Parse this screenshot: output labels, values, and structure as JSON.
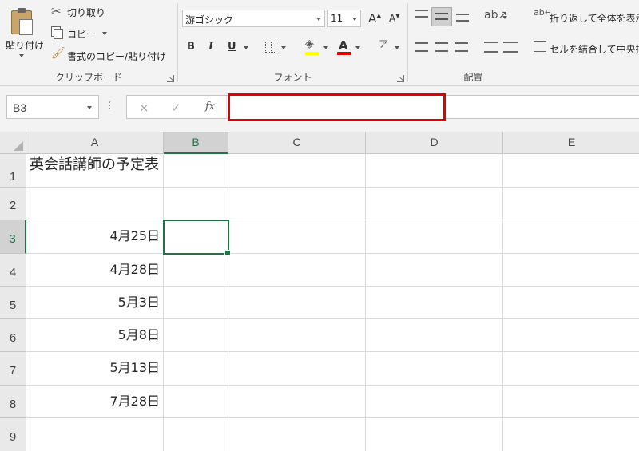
{
  "ribbon": {
    "clipboard": {
      "paste_label": "貼り付け",
      "cut_label": "切り取り",
      "copy_label": "コピー",
      "format_painter_label": "書式のコピー/貼り付け",
      "group_label": "クリップボード"
    },
    "font": {
      "font_name": "游ゴシック",
      "font_size": "11",
      "bold_label": "B",
      "italic_label": "I",
      "underline_label": "U",
      "font_color_label": "A",
      "group_label": "フォント",
      "font_color": "#e00000",
      "fill_color": "#ffff00"
    },
    "alignment": {
      "wrap_text_label": "折り返して全体を表示",
      "merge_center_label": "セルを結合して中央揃え",
      "group_label": "配置"
    }
  },
  "formula_bar": {
    "name_box": "B3",
    "fx_label": "fx",
    "cancel_icon": "×",
    "enter_icon": "✓",
    "formula_value": ""
  },
  "sheet": {
    "columns": [
      "A",
      "B",
      "C",
      "D",
      "E"
    ],
    "selected_column": "B",
    "rows": [
      "1",
      "2",
      "3",
      "4",
      "5",
      "6",
      "7",
      "8",
      "9"
    ],
    "selected_row": "3",
    "active_cell": "B3",
    "cells": {
      "A1": "英会話講師の予定表",
      "A3": "4月25日",
      "A4": "4月28日",
      "A5": "5月3日",
      "A6": "5月8日",
      "A7": "5月13日",
      "A8": "7月28日"
    }
  },
  "colors": {
    "accent": "#217346",
    "highlight_box": "#e00000"
  }
}
